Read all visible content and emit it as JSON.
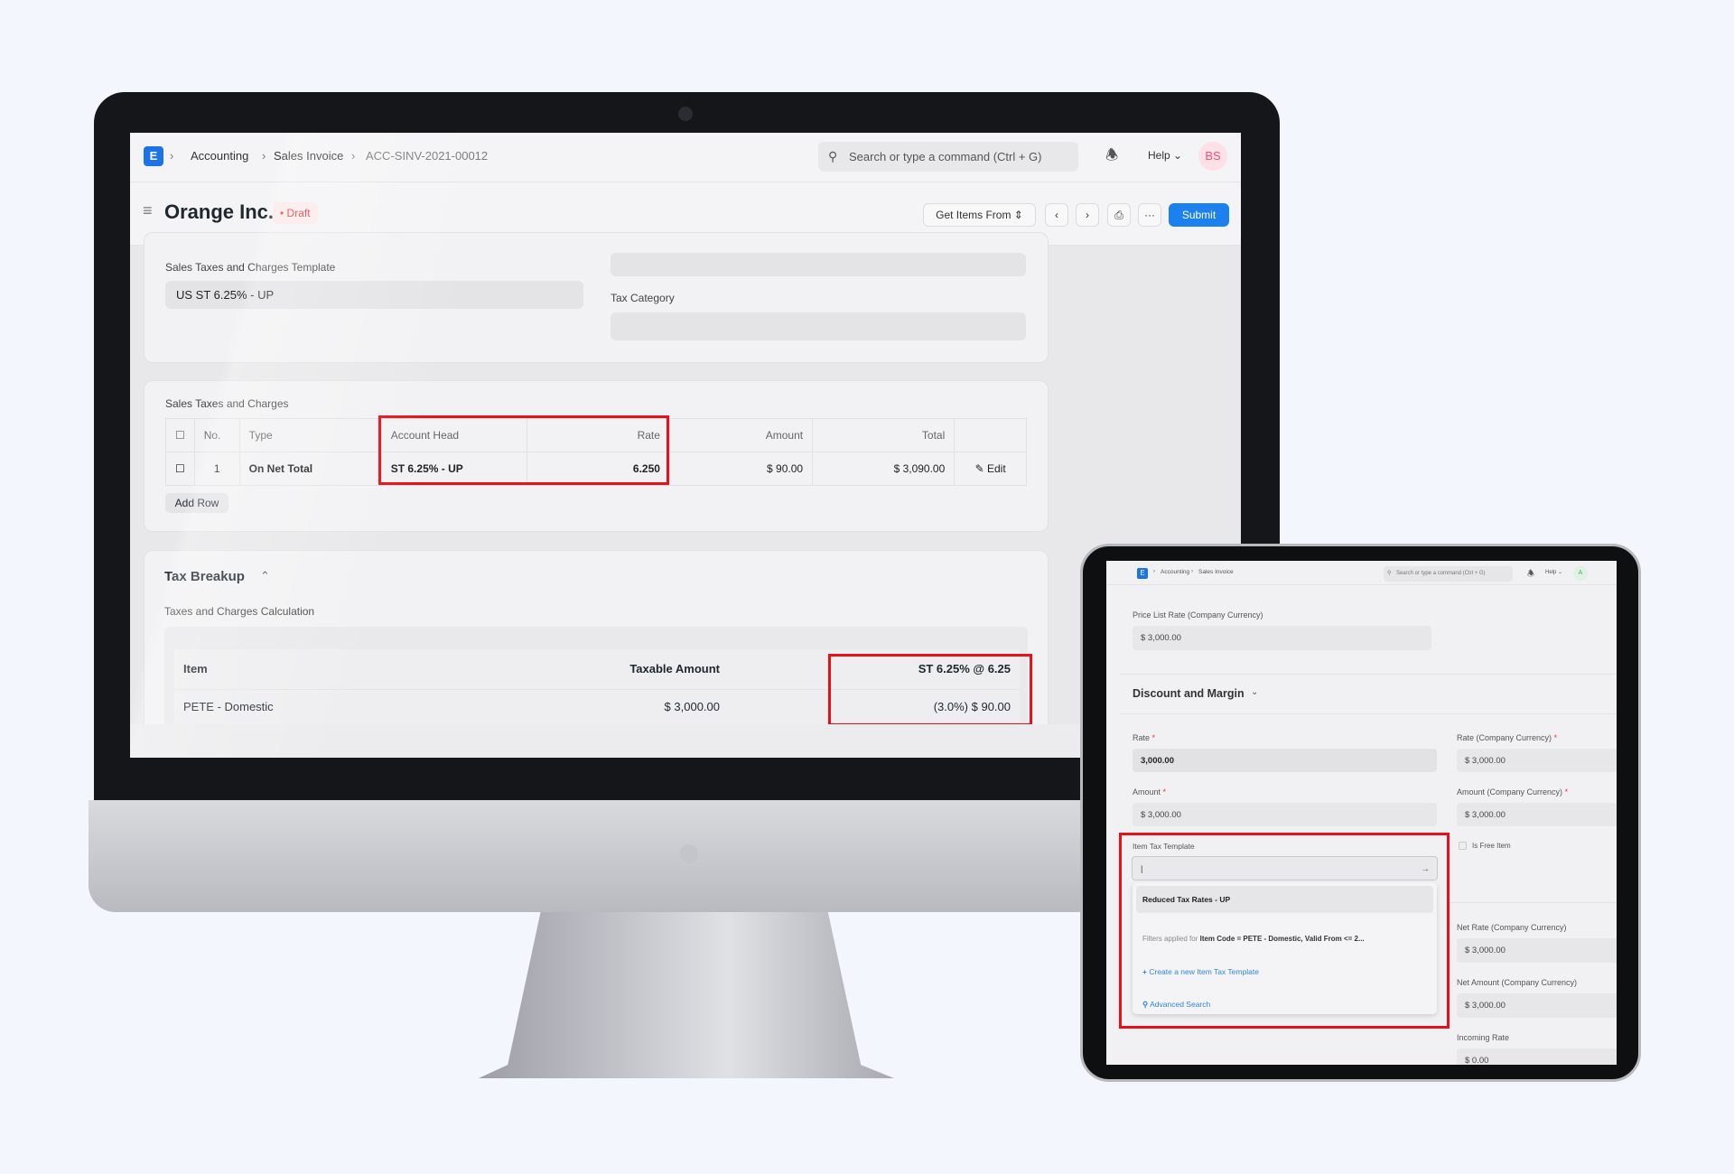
{
  "desktop": {
    "logo": "E",
    "breadcrumb": [
      "Accounting",
      "Sales Invoice",
      "ACC-SINV-2021-00012"
    ],
    "search_placeholder": "Search or type a command (Ctrl + G)",
    "help": "Help",
    "avatar": "BS",
    "title": "Orange Inc.",
    "status": "Draft",
    "buttons": {
      "get_items": "Get Items From",
      "submit": "Submit"
    },
    "fields": {
      "template_label": "Sales Taxes and Charges Template",
      "template_value": "US ST 6.25% - UP",
      "tax_category_label": "Tax Category"
    },
    "taxes": {
      "label": "Sales Taxes and Charges",
      "headers": [
        "No.",
        "Type",
        "Account Head",
        "Rate",
        "Amount",
        "Total"
      ],
      "rows": [
        {
          "no": "1",
          "type": "On Net Total",
          "account_head": "ST 6.25% - UP",
          "rate": "6.250",
          "amount": "$ 90.00",
          "total": "$ 3,090.00",
          "edit": "Edit"
        }
      ],
      "add_row": "Add Row"
    },
    "breakup": {
      "title": "Tax Breakup",
      "subtitle": "Taxes and Charges Calculation",
      "headers": [
        "Item",
        "Taxable Amount",
        "ST 6.25% @ 6.25"
      ],
      "rows": [
        {
          "item": "PETE - Domestic",
          "taxable": "$ 3,000.00",
          "tax": "(3.0%) $ 90.00"
        }
      ]
    },
    "highlight_color": "#e8101a",
    "accent": "#1c80ee"
  },
  "tablet": {
    "breadcrumb": [
      "Accounting",
      "Sales Invoice"
    ],
    "search_placeholder": "Search or type a command (Ctrl + G)",
    "help": "Help",
    "avatar": "A",
    "price_list_rate_label": "Price List Rate (Company Currency)",
    "price_list_rate": "$ 3,000.00",
    "section": "Discount and Margin",
    "rate_label": "Rate",
    "rate": "3,000.00",
    "amount_label": "Amount",
    "amount": "$ 3,000.00",
    "rate_cc_label": "Rate (Company Currency)",
    "rate_cc": "$ 3,000.00",
    "amount_cc_label": "Amount (Company Currency)",
    "amount_cc": "$ 3,000.00",
    "item_tax_label": "Item Tax Template",
    "item_tax_value": "",
    "is_free_item": "Is Free Item",
    "dropdown": {
      "option": "Reduced Tax Rates - UP",
      "filter_prefix": "Filters applied for ",
      "filter_text": "Item Code = PETE - Domestic, Valid From <= 2...",
      "create": "Create a new Item Tax Template",
      "advanced": "Advanced Search"
    },
    "net_rate_label": "Net Rate (Company Currency)",
    "net_rate": "$ 3,000.00",
    "net_amount_label": "Net Amount (Company Currency)",
    "net_amount": "$ 3,000.00",
    "incoming_rate_label": "Incoming Rate",
    "incoming_rate": "$ 0.00"
  }
}
